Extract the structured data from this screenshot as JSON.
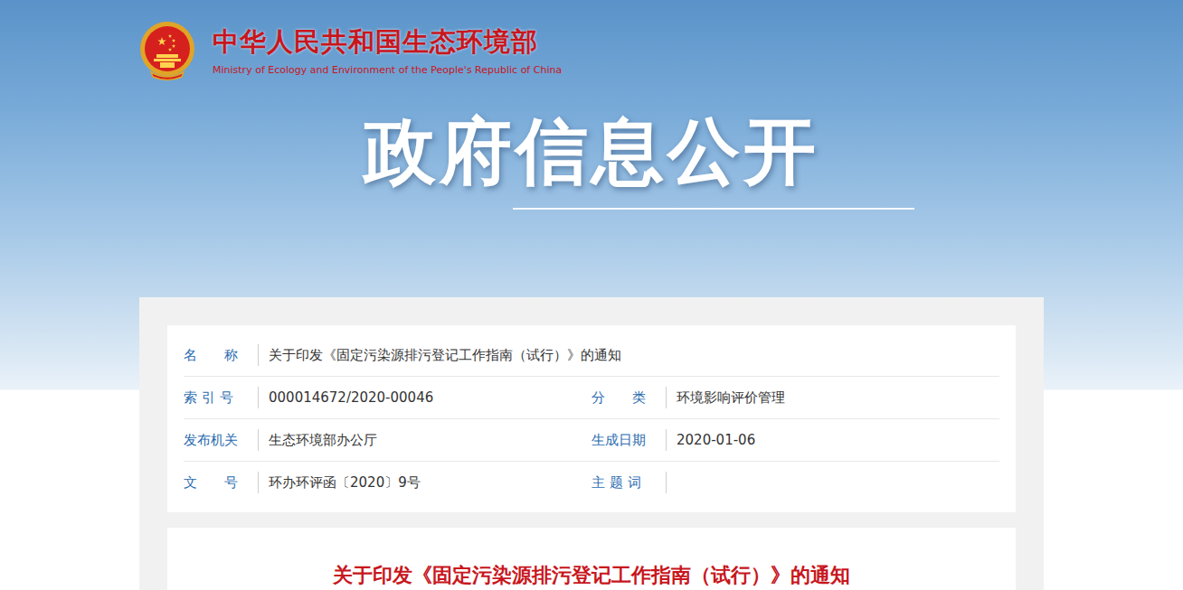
{
  "header": {
    "ministry_name": "中华人民共和国生态环境部",
    "ministry_name_en": "Ministry of Ecology and Environment of the People's Republic of China",
    "banner_title": "政府信息公开"
  },
  "info_table": {
    "rows": [
      [
        {
          "label": "名　　称",
          "value": "关于印发《固定污染源排污登记工作指南（试行）》的通知"
        }
      ],
      [
        {
          "label": "索 引 号",
          "value": "000014672/2020-00046"
        },
        {
          "label": "分　　类",
          "value": "环境影响评价管理"
        }
      ],
      [
        {
          "label": "发布机关",
          "value": "生态环境部办公厅"
        },
        {
          "label": "生成日期",
          "value": "2020-01-06"
        }
      ],
      [
        {
          "label": "文　　号",
          "value": "环办环评函〔2020〕9号"
        },
        {
          "label": "主 题 词",
          "value": ""
        }
      ]
    ]
  },
  "document": {
    "title": "关于印发《固定污染源排污登记工作指南（试行）》的通知"
  }
}
